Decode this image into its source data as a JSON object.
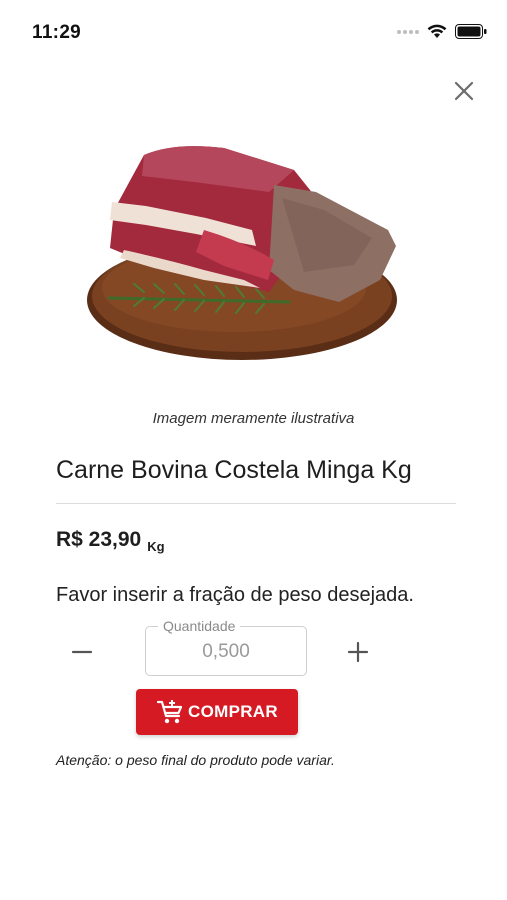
{
  "status_bar": {
    "time": "11:29"
  },
  "product": {
    "image_caption": "Imagem meramente ilustrativa",
    "title": "Carne Bovina Costela Minga Kg",
    "price": "R$ 23,90",
    "price_unit": "Kg"
  },
  "quantity": {
    "instruction": "Favor inserir a fração de peso desejada.",
    "label": "Quantidade",
    "value": "0,500"
  },
  "buy_button": {
    "label": "COMPRAR"
  },
  "warning": "Atenção: o peso final do produto pode variar.",
  "colors": {
    "accent": "#d51a24",
    "text": "#1e1e1e"
  },
  "icons": {
    "close": "close-icon",
    "minus": "minus-icon",
    "plus": "plus-icon",
    "cart": "add-to-cart-icon",
    "wifi": "wifi-icon",
    "battery": "battery-icon"
  }
}
